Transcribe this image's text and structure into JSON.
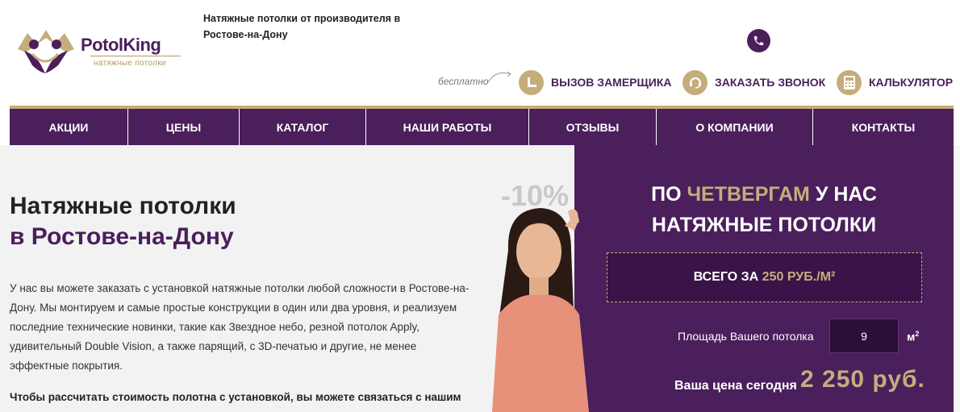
{
  "header": {
    "brand_name": "PotolKing",
    "brand_sub": "натяжные потолки",
    "tagline": "Натяжные потолки от производителя в Ростове-на-Дону",
    "free_note": "бесплатно",
    "actions": [
      {
        "label": "ВЫЗОВ ЗАМЕРЩИКА",
        "icon": "measure-icon"
      },
      {
        "label": "ЗАКАЗАТЬ ЗВОНОК",
        "icon": "headset-icon"
      },
      {
        "label": "КАЛЬКУЛЯТОР",
        "icon": "calculator-icon"
      }
    ]
  },
  "nav": {
    "items": [
      "АКЦИИ",
      "ЦЕНЫ",
      "КАТАЛОГ",
      "НАШИ РАБОТЫ",
      "ОТЗЫВЫ",
      "О КОМПАНИИ",
      "КОНТАКТЫ"
    ]
  },
  "main": {
    "title_line1": "Натяжные потолки",
    "title_line2": "в Ростове-на-Дону",
    "paragraph": "У нас вы можете заказать с установкой натяжные потолки любой сложности в Ростове-на-Дону. Мы монтируем и самые простые конструкции в один или два уровня, и реализуем последние технические новинки, такие как Звездное небо, резной потолок Apply, удивительный Double Vision, а также парящий, с 3D-печатью и другие, не менее эффектные покрытия.",
    "paragraph2": "Чтобы рассчитать стоимость полотна с установкой, вы можете связаться с нашим",
    "discount_badge": "-10%"
  },
  "promo": {
    "title_pre": "ПО ",
    "title_highlight": "ЧЕТВЕРГАМ",
    "title_post": " У НАС",
    "title_line2": "НАТЯЖНЫЕ ПОТОЛКИ",
    "price_pre": "ВСЕГО ЗА ",
    "price_value": "250 РУБ./М²",
    "area_label": "Площадь Вашего потолка",
    "area_value": "9",
    "area_unit": "м",
    "area_unit_sup": "2",
    "today_label": "Ваша цена сегодня",
    "today_price": "2 250 руб."
  },
  "colors": {
    "purple": "#4a1f5c",
    "gold": "#c5ad7b",
    "light_bg": "#f2f2f2"
  }
}
